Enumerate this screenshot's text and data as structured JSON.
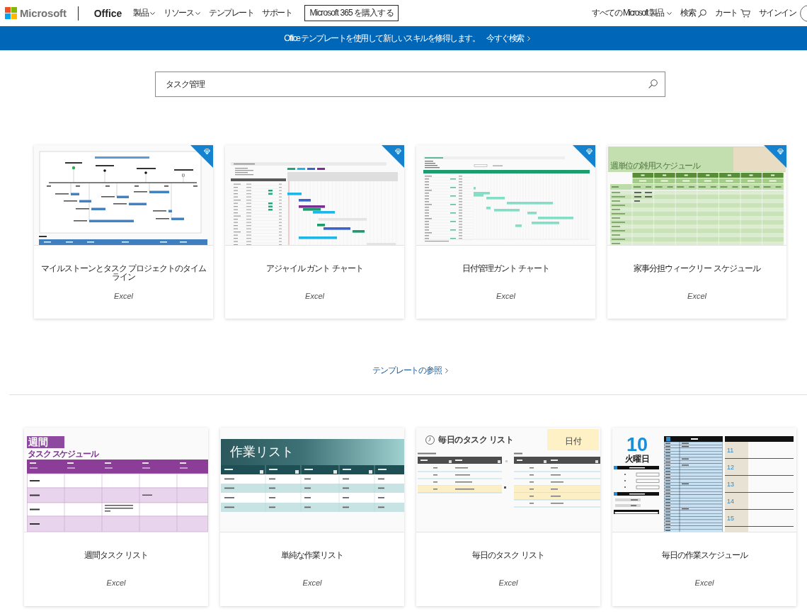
{
  "header": {
    "logo": "Microsoft",
    "product": "Office",
    "nav": [
      {
        "label": "製品",
        "kind": "dropdown"
      },
      {
        "label": "リソース",
        "kind": "dropdown"
      },
      {
        "label": "テンプレート",
        "kind": "link"
      },
      {
        "label": "サポート",
        "kind": "link"
      }
    ],
    "buy_button": "Microsoft 365 を購入する",
    "utility": [
      {
        "label": "すべての Microsoft 製品",
        "kind": "dropdown"
      },
      {
        "label": "検索",
        "kind": "search"
      },
      {
        "label": "カート",
        "kind": "cart"
      },
      {
        "label": "サインイン",
        "kind": "link"
      }
    ]
  },
  "banner": {
    "message": "Office テンプレートを使用して新しいスキルを修得します。",
    "link": "今すぐ検索"
  },
  "search": {
    "value": "タスク管理"
  },
  "featured": [
    {
      "title": "マイルストーンとタスク プロジェクトのタイムライン",
      "app": "Excel",
      "premium": true,
      "preview": {
        "kind": "timeline"
      }
    },
    {
      "title": "アジャイル ガント チャート",
      "app": "Excel",
      "premium": true,
      "preview": {
        "kind": "agile_gantt"
      }
    },
    {
      "title": "日付管理ガント チャート",
      "app": "Excel",
      "premium": true,
      "preview": {
        "kind": "date_gantt"
      }
    },
    {
      "title": "家事分担ウィークリー スケジュール",
      "app": "Excel",
      "premium": true,
      "preview": {
        "kind": "chores",
        "title": "週単位の雑用スケジュール"
      }
    }
  ],
  "browse_link": "テンプレートの参照",
  "results": [
    {
      "title": "週間タスク リスト",
      "app": "Excel",
      "premium": false,
      "preview": {
        "kind": "weekly_tasks",
        "title": "週間",
        "subtitle": "タスク スケジュール"
      }
    },
    {
      "title": "単純な作業リスト",
      "app": "Excel",
      "premium": false,
      "preview": {
        "kind": "work_list",
        "title": "作業リスト"
      }
    },
    {
      "title": "毎日のタスク リスト",
      "app": "Excel",
      "premium": false,
      "preview": {
        "kind": "daily_tasks",
        "title": "毎日のタスク リスト",
        "date_label": "日付"
      }
    },
    {
      "title": "毎日の作業スケジュール",
      "app": "Excel",
      "premium": false,
      "preview": {
        "kind": "daily_schedule",
        "day": "10",
        "weekday": "火曜日",
        "day_numbers": [
          "11",
          "12",
          "13",
          "14",
          "15"
        ]
      }
    }
  ]
}
